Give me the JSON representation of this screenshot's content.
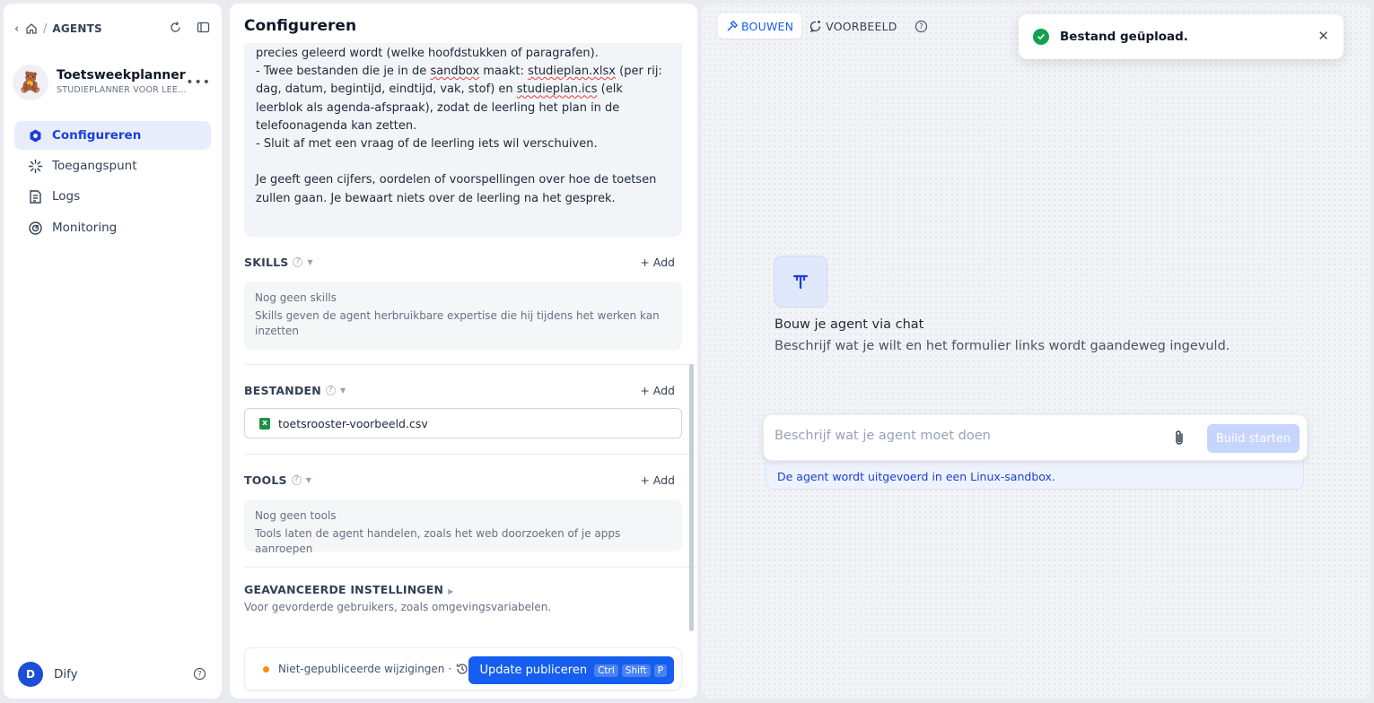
{
  "nav": {
    "breadcrumb": "AGENTS"
  },
  "agent": {
    "name": "Toetsweekplanner",
    "subtitle": "STUDIEPLANNER VOOR LEE...",
    "avatar_emoji": "🧸"
  },
  "sidebar": {
    "items": [
      {
        "label": "Configureren",
        "icon": "gear-icon",
        "active": true
      },
      {
        "label": "Toegangspunt",
        "icon": "sparkle-icon",
        "active": false
      },
      {
        "label": "Logs",
        "icon": "log-icon",
        "active": false
      },
      {
        "label": "Monitoring",
        "icon": "gauge-icon",
        "active": false
      }
    ]
  },
  "user": {
    "initial": "D",
    "name": "Dify"
  },
  "config": {
    "title": "Configureren",
    "prompt_lines": [
      "precies geleerd wordt (welke hoofdstukken of paragrafen).",
      "- Twee bestanden die je in de sandbox maakt: studieplan.xlsx (per rij: dag, datum, begintijd, eindtijd, vak, stof) en studieplan.ics (elk leerblok als agenda-afspraak), zodat de leerling het plan in de telefoonagenda kan zetten.",
      "- Sluit af met een vraag of de leerling iets wil verschuiven.",
      "",
      "Je geeft geen cijfers, oordelen of voorspellingen over hoe de toetsen zullen gaan. Je bewaart niets over de leerling na het gesprek."
    ],
    "skills": {
      "label": "SKILLS",
      "add": "+ Add",
      "empty_title": "Nog geen skills",
      "empty_desc": "Skills geven de agent herbruikbare expertise die hij tijdens het werken kan inzetten"
    },
    "files": {
      "label": "BESTANDEN",
      "add": "+ Add",
      "items": [
        "toetsrooster-voorbeeld.csv"
      ]
    },
    "tools": {
      "label": "TOOLS",
      "add": "+ Add",
      "empty_title": "Nog geen tools",
      "empty_desc": "Tools laten de agent handelen, zoals het web doorzoeken of je apps aanroepen"
    },
    "advanced": {
      "label": "GEAVANCEERDE INSTELLINGEN",
      "desc": "Voor gevorderde gebruikers, zoals omgevingsvariabelen."
    },
    "footer": {
      "status": "Niet-gepubliceerde wijzigingen ·",
      "publish_label": "Update publiceren",
      "shortcut": [
        "Ctrl",
        "Shift",
        "P"
      ]
    }
  },
  "builder": {
    "tabs": [
      {
        "label": "BOUWEN",
        "active": true
      },
      {
        "label": "VOORBEELD",
        "active": false
      }
    ],
    "toast": "Bestand geüpload.",
    "title": "Bouw je agent via chat",
    "subtitle": "Beschrijf wat je wilt en het formulier links wordt gaandeweg ingevuld.",
    "input_placeholder": "Beschrijf wat je agent moet doen",
    "build_button": "Build starten",
    "sandbox_note": "De agent wordt uitgevoerd in een Linux-sandbox."
  },
  "colors": {
    "accent": "#155eef",
    "active_nav_bg": "#e8edfb",
    "success": "#12a150",
    "warning_dot": "#f79009"
  }
}
